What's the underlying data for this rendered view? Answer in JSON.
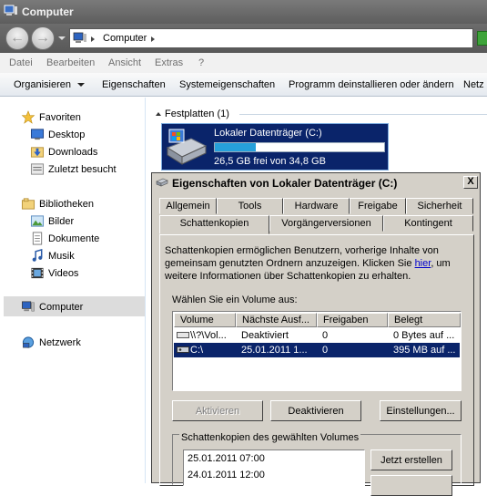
{
  "window": {
    "title": "Computer",
    "address_location": "Computer",
    "nav_back_icon": "back-arrow-icon",
    "nav_forward_icon": "forward-arrow-icon"
  },
  "menubar": {
    "items": [
      "Datei",
      "Bearbeiten",
      "Ansicht",
      "Extras",
      "?"
    ]
  },
  "cmdbar": {
    "items": [
      "Organisieren",
      "Eigenschaften",
      "Systemeigenschaften",
      "Programm deinstallieren oder ändern",
      "Netz"
    ]
  },
  "navpane": {
    "favorites_label": "Favoriten",
    "favorites": [
      "Desktop",
      "Downloads",
      "Zuletzt besucht"
    ],
    "libraries_label": "Bibliotheken",
    "libraries": [
      "Bilder",
      "Dokumente",
      "Musik",
      "Videos"
    ],
    "computer_label": "Computer",
    "network_label": "Netzwerk"
  },
  "content": {
    "group_header": "Festplatten (1)",
    "drive": {
      "name": "Lokaler Datenträger (C:)",
      "free_text": "26,5 GB frei von 34,8 GB",
      "used_fraction": 0.24
    }
  },
  "dialog": {
    "title": "Eigenschaften von Lokaler Datenträger (C:)",
    "close_label": "X",
    "tabs_row1": [
      "Allgemein",
      "Tools",
      "Hardware",
      "Freigabe",
      "Sicherheit"
    ],
    "tabs_row2": [
      "Schattenkopien",
      "Vorgängerversionen",
      "Kontingent"
    ],
    "active_tab": "Schattenkopien",
    "description_before_link": "Schattenkopien ermöglichen Benutzern, vorherige Inhalte von gemeinsam genutzten Ordnern anzuzeigen. Klicken Sie ",
    "description_link": "hier",
    "description_after_link": ", um weitere Informationen über Schattenkopien zu erhalten.",
    "volume_label": "Wählen Sie ein Volume aus:",
    "columns": [
      "Volume",
      "Nächste Ausf...",
      "Freigaben",
      "Belegt"
    ],
    "rows": [
      {
        "volume": "\\\\?\\Vol...",
        "next": "Deaktiviert",
        "shares": "0",
        "used": "0 Bytes auf ..."
      },
      {
        "volume": "C:\\",
        "next": "25.01.2011 1...",
        "shares": "0",
        "used": "395 MB auf ..."
      }
    ],
    "selected_row": 1,
    "buttons": {
      "activate": "Aktivieren",
      "deactivate": "Deaktivieren",
      "settings": "Einstellungen..."
    },
    "snapshots_label": "Schattenkopien des gewählten Volumes",
    "snapshots": [
      "25.01.2011 07:00",
      "24.01.2011 12:00"
    ],
    "create_now": "Jetzt erstellen"
  }
}
